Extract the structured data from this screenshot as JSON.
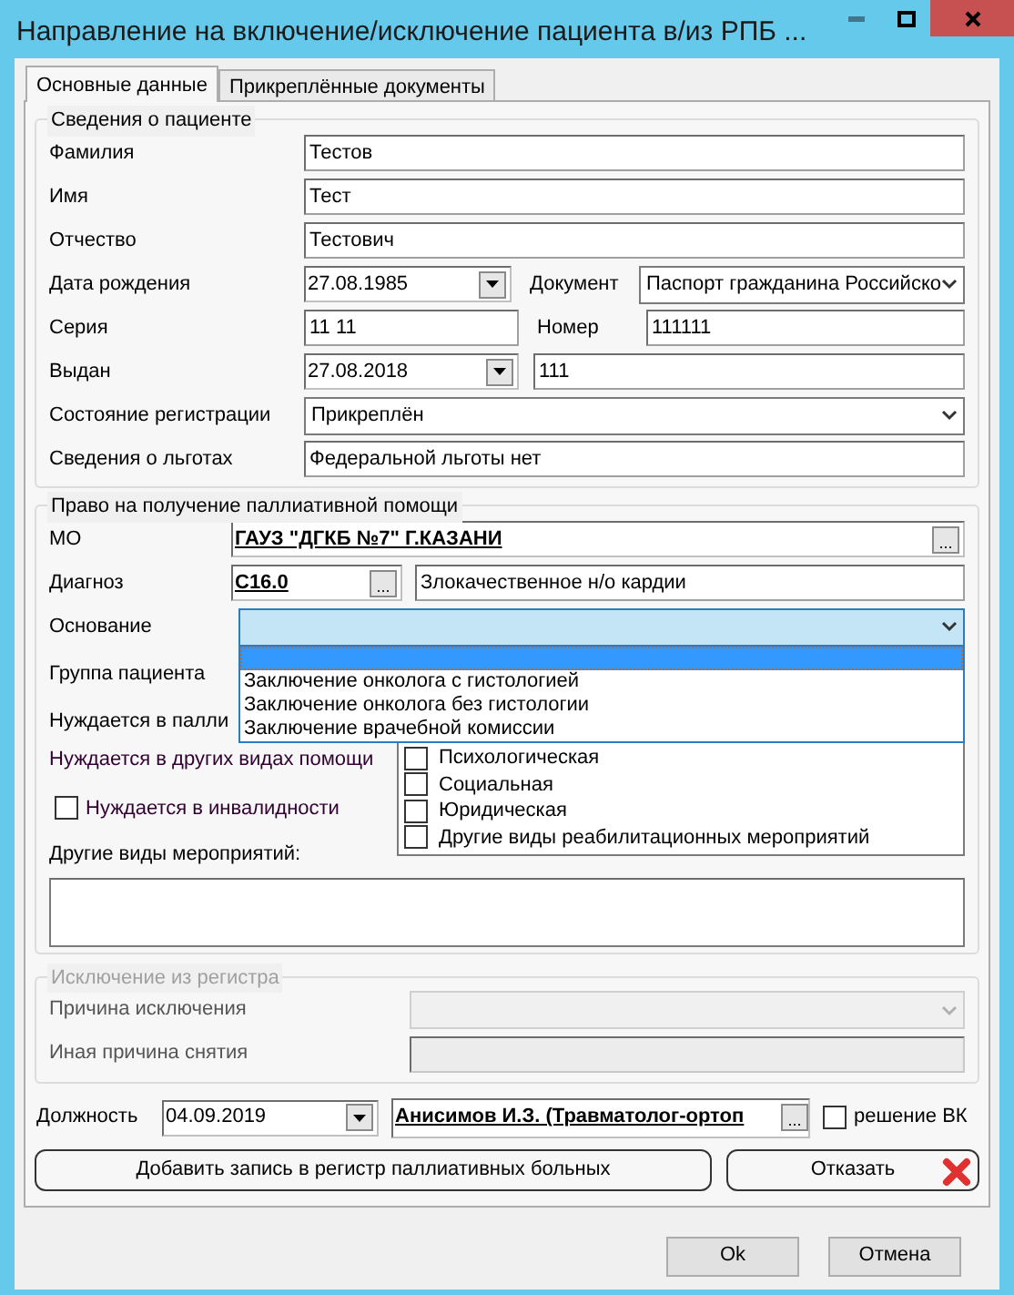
{
  "window": {
    "title": "Направление на включение/исключение пациента в/из РПБ ..."
  },
  "tabs": [
    {
      "label": "Основные данные",
      "selected": true
    },
    {
      "label": "Прикреплённые документы",
      "selected": false
    }
  ],
  "patient": {
    "title": "Сведения о пациенте",
    "last_name": {
      "label": "Фамилия",
      "value": "Тестов"
    },
    "first_name": {
      "label": "Имя",
      "value": "Тест"
    },
    "patronymic": {
      "label": "Отчество",
      "value": "Тестович"
    },
    "birth_date": {
      "label": "Дата рождения",
      "value": "27.08.1985"
    },
    "document": {
      "label": "Документ",
      "value": "Паспорт гражданина Российско"
    },
    "series": {
      "label": "Серия",
      "value": "11 11"
    },
    "number": {
      "label": "Номер",
      "value": "111111"
    },
    "issued": {
      "label": "Выдан",
      "date": "27.08.2018",
      "by": "111"
    },
    "registration": {
      "label": "Состояние регистрации",
      "value": "Прикреплён"
    },
    "benefits": {
      "label": "Сведения о льготах",
      "value": "Федеральной льготы нет"
    }
  },
  "palliative": {
    "title": "Право на получение паллиативной помощи",
    "mo": {
      "label": "МО",
      "value": "ГАУЗ \"ДГКБ №7\" Г.КАЗАНИ",
      "browse": "..."
    },
    "diagnosis": {
      "label": "Диагноз",
      "code": "C16.0",
      "browse": "...",
      "name": "Злокачественное н/о кардии"
    },
    "basis": {
      "label": "Основание",
      "expanded": true,
      "blank_option_highlighted": true,
      "options": [
        {
          "label": "Заключение онколога с гистологией"
        },
        {
          "label": "Заключение онколога без гистологии"
        },
        {
          "label": "Заключение врачебной комиссии"
        }
      ]
    },
    "patient_group": {
      "label": "Группа пациента"
    },
    "needs_palliative": {
      "label": "Нуждается в палли"
    },
    "other_help": {
      "label": "Нуждается в других видах помощи",
      "options": [
        {
          "label": "Психологическая",
          "checked": false
        },
        {
          "label": "Социальная",
          "checked": false
        },
        {
          "label": "Юридическая",
          "checked": false
        },
        {
          "label": "Другие виды реабилитационных мероприятий",
          "checked": false
        }
      ]
    },
    "disability": {
      "label": "Нуждается в инвалидности",
      "checked": false
    },
    "other_measures": {
      "label": "Другие виды мероприятий:"
    }
  },
  "exclusion": {
    "title": "Исключение из регистра",
    "disabled": true,
    "reason": {
      "label": "Причина исключения"
    },
    "other_reason": {
      "label": "Иная причина снятия"
    }
  },
  "position": {
    "label": "Должность",
    "date": "04.09.2019",
    "doctor": "Анисимов И.З. (Травматолог-ортоп",
    "browse": "...",
    "vk": {
      "label": "решение ВК",
      "checked": false
    }
  },
  "actions": [
    {
      "label": "Добавить запись в регистр паллиативных больных",
      "kind": "add"
    },
    {
      "label": "Отказать",
      "kind": "refuse"
    }
  ],
  "buttons": [
    {
      "label": "Ok"
    },
    {
      "label": "Отмена"
    }
  ]
}
